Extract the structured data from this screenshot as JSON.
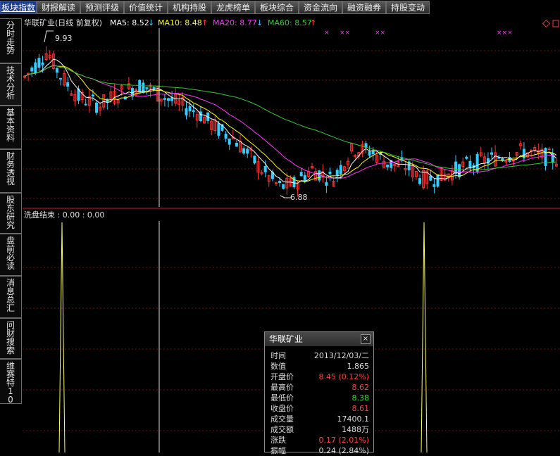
{
  "toolbar": {
    "items": [
      "板块指数",
      "财报解读",
      "预测评级",
      "价值统计",
      "机构持股",
      "龙虎榜单",
      "板块综合",
      "资金流向",
      "融资融券",
      "持股变动"
    ]
  },
  "sidebar": {
    "items": [
      "分时走势",
      "技术分析",
      "基本资料",
      "财务透视",
      "股东研究",
      "盘前必读",
      "消息总汇",
      "问财搜索",
      "维赛特10"
    ]
  },
  "chart": {
    "title": "华联矿业(日线 前复权)",
    "ma5": "MA5: 8.52",
    "ma10": "MA10: 8.48",
    "ma20": "MA20: 8.77",
    "ma60": "MA60: 8.57",
    "high_label": "9.93",
    "low_label": "6.88",
    "markers": [
      "×",
      "××",
      "××",
      "×××"
    ],
    "indicator_label": "洗盘结束 : 0.00 : 0.00"
  },
  "colors": {
    "ma5": "#ffffff",
    "ma10": "#ffff00",
    "ma20": "#ff33ff",
    "ma60": "#33cc33",
    "up": "#ff3232",
    "down": "#33ccff",
    "grid": "#7a1010",
    "indicator": "#ffff66"
  },
  "infobox": {
    "title": "华联矿业",
    "close": "×",
    "rows": [
      {
        "label": "时间",
        "value": "2013/12/03/二",
        "color": "#dddddd"
      },
      {
        "label": "数值",
        "value": "1.865",
        "color": "#dddddd"
      },
      {
        "label": "开盘价",
        "value": "8.45 (0.12%)",
        "color": "#ff4040"
      },
      {
        "label": "最高价",
        "value": "8.62",
        "color": "#ff4040"
      },
      {
        "label": "最低价",
        "value": "8.38",
        "color": "#33dd33"
      },
      {
        "label": "收盘价",
        "value": "8.61",
        "color": "#ff4040"
      },
      {
        "label": "成交量",
        "value": "17400.1",
        "color": "#dddddd"
      },
      {
        "label": "成交额",
        "value": "1488万",
        "color": "#dddddd"
      },
      {
        "label": "涨跌",
        "value": "0.17 (2.01%)",
        "color": "#ff4040"
      },
      {
        "label": "振幅",
        "value": "0.24 (2.84%)",
        "color": "#dddddd"
      }
    ]
  }
}
